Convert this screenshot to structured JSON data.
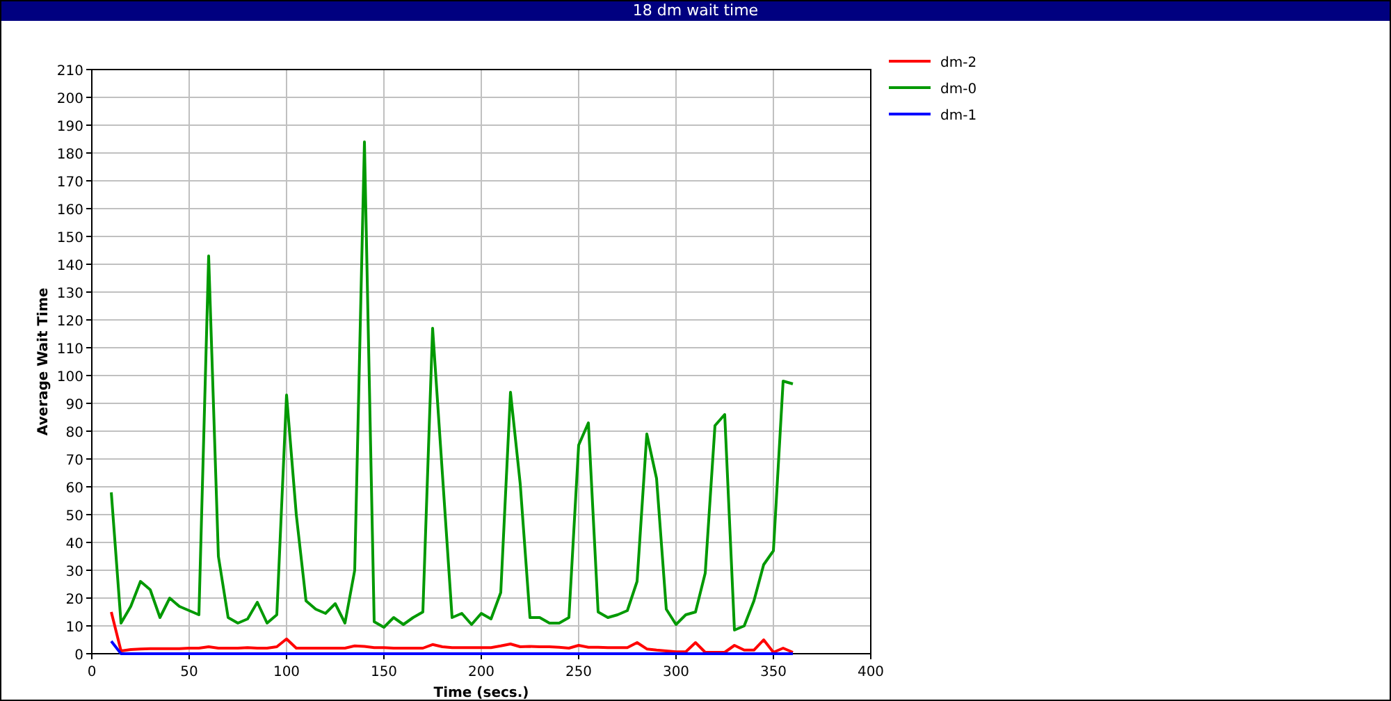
{
  "window": {
    "title": "18 dm wait time"
  },
  "chart": {
    "chart_data": {
      "type": "line",
      "xlabel": "Time (secs.)",
      "ylabel": "Average Wait Time",
      "x": [
        10,
        15,
        20,
        25,
        30,
        35,
        40,
        45,
        50,
        55,
        60,
        65,
        70,
        75,
        80,
        85,
        90,
        95,
        100,
        105,
        110,
        115,
        120,
        125,
        130,
        135,
        140,
        145,
        150,
        155,
        160,
        165,
        170,
        175,
        180,
        185,
        190,
        195,
        200,
        205,
        210,
        215,
        220,
        225,
        230,
        235,
        240,
        245,
        250,
        255,
        260,
        265,
        270,
        275,
        280,
        285,
        290,
        295,
        300,
        305,
        310,
        315,
        320,
        325,
        330,
        335,
        340,
        345,
        350,
        355,
        360
      ],
      "series": [
        {
          "name": "dm-2",
          "color": "#ff0000",
          "values": [
            15,
            1,
            1.5,
            1.7,
            1.8,
            1.8,
            1.8,
            1.8,
            2,
            2,
            2.5,
            2,
            2,
            2,
            2.2,
            2,
            2,
            2.5,
            5.3,
            2,
            2,
            2,
            2,
            2,
            2,
            2.8,
            2.6,
            2.2,
            2.2,
            2,
            2,
            2,
            2,
            3.3,
            2.5,
            2.2,
            2.2,
            2.2,
            2.2,
            2.2,
            2.8,
            3.5,
            2.5,
            2.6,
            2.5,
            2.5,
            2.3,
            2,
            3,
            2.3,
            2.3,
            2.2,
            2.2,
            2.2,
            4,
            1.7,
            1.3,
            1,
            0.7,
            0.7,
            4,
            0.5,
            0.5,
            0.5,
            3,
            1.3,
            1.3,
            5,
            0.5,
            2,
            0.5
          ]
        },
        {
          "name": "dm-0",
          "color": "#009900",
          "values": [
            58,
            11,
            17,
            26,
            23,
            13,
            20,
            17,
            15.5,
            14,
            143,
            35,
            13,
            11,
            12.5,
            18.5,
            11,
            14,
            93,
            50,
            19,
            16,
            14.5,
            18,
            11,
            30,
            184,
            11.5,
            9.5,
            13,
            10.5,
            13,
            15,
            117,
            65,
            13,
            14.5,
            10.5,
            14.5,
            12.5,
            22,
            94,
            61,
            13,
            13,
            11,
            11,
            13,
            75,
            83,
            15,
            13,
            14,
            15.5,
            26,
            79,
            63,
            16,
            10.5,
            14,
            15,
            29,
            82,
            86,
            8.5,
            10,
            19,
            32,
            37,
            98,
            97
          ]
        },
        {
          "name": "dm-1",
          "color": "#0000ff",
          "values": [
            4.5,
            0,
            0,
            0,
            0,
            0,
            0,
            0,
            0,
            0,
            0,
            0,
            0,
            0,
            0,
            0,
            0,
            0,
            0,
            0,
            0,
            0,
            0,
            0,
            0,
            0,
            0,
            0,
            0,
            0,
            0,
            0,
            0,
            0,
            0,
            0,
            0,
            0,
            0,
            0,
            0,
            0,
            0,
            0,
            0,
            0,
            0,
            0,
            0,
            0,
            0,
            0,
            0,
            0,
            0,
            0,
            0,
            0,
            0,
            0,
            0,
            0,
            0,
            0,
            0,
            0,
            0,
            0,
            0,
            0,
            0
          ]
        }
      ],
      "xlim": [
        0,
        400
      ],
      "ylim": [
        0,
        210
      ],
      "xticks": [
        0,
        50,
        100,
        150,
        200,
        250,
        300,
        350,
        400
      ],
      "grid": true,
      "legend": true,
      "yticks": [
        0,
        10,
        20,
        30,
        40,
        50,
        60,
        70,
        80,
        90,
        100,
        110,
        120,
        130,
        140,
        150,
        160,
        170,
        180,
        190,
        200,
        210
      ]
    }
  }
}
